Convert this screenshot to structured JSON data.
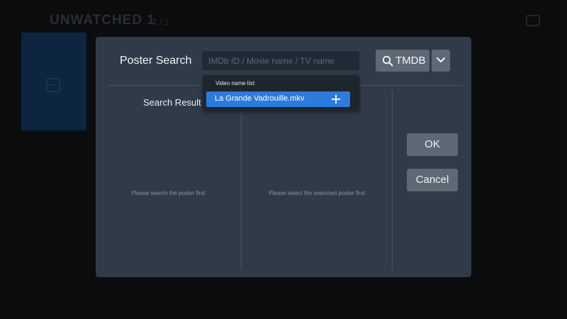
{
  "background": {
    "title": "UNWATCHED 1",
    "subtitle": "1 / 2"
  },
  "dialog": {
    "title": "Poster Search",
    "search": {
      "placeholder": "IMDb ID / Movie name / TV name",
      "value": ""
    },
    "provider": {
      "label": "TMDB",
      "icon": "search-icon"
    },
    "dropdown_icon": "chevron-down-icon",
    "columns": {
      "search_result_heading": "Search Result",
      "left_hint": "Please search the poster first",
      "middle_hint": "Please select the searched poster first"
    },
    "buttons": {
      "ok": "OK",
      "cancel": "Cancel"
    }
  },
  "popup": {
    "title": "Video name list:",
    "items": [
      {
        "label": "La Grande Vadrouille.mkv",
        "icon": "plus-icon",
        "selected": true
      }
    ]
  },
  "colors": {
    "dialog_bg": "#2f3b48",
    "button_bg": "#5e6975",
    "popup_bg": "#1e252d",
    "accent": "#2d7bdb"
  }
}
